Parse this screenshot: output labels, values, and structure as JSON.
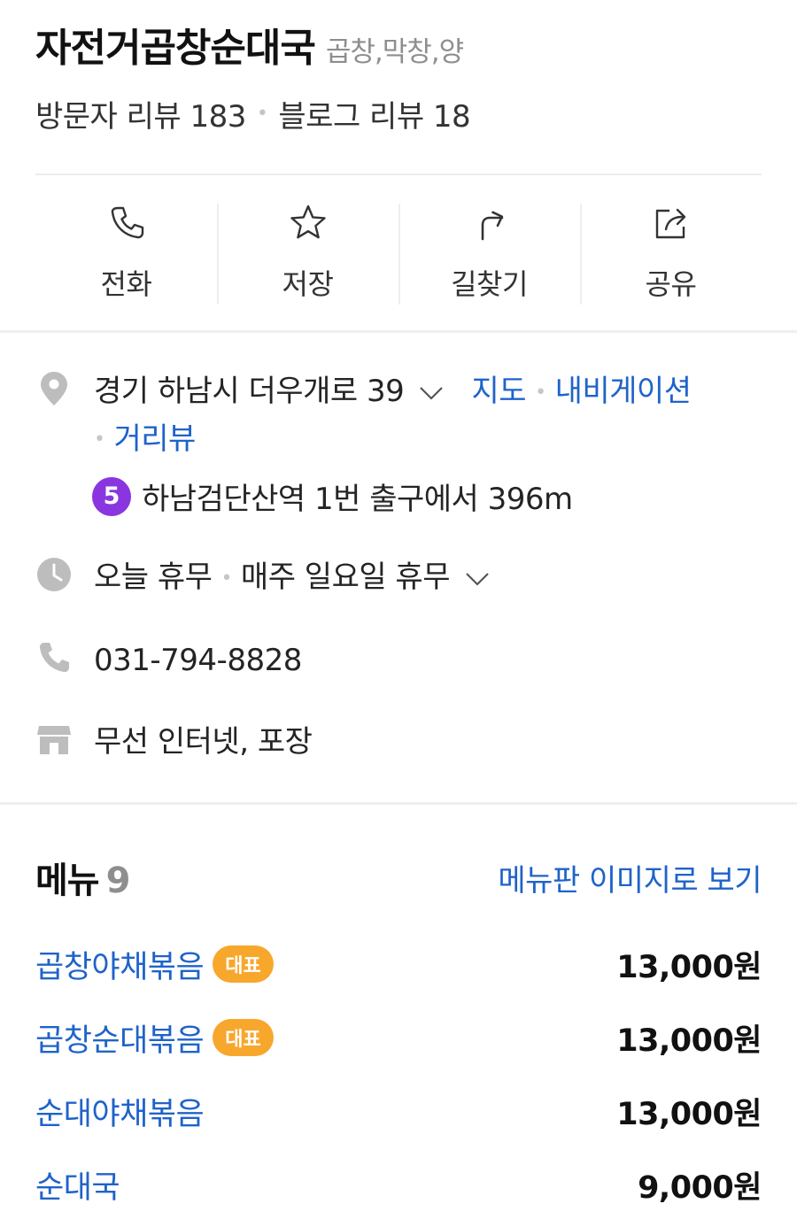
{
  "place": {
    "name": "자전거곱창순대국",
    "category": "곱창,막창,양",
    "visitor_reviews": "방문자 리뷰 183",
    "blog_reviews": "블로그 리뷰 18"
  },
  "actions": [
    {
      "label": "전화",
      "icon": "phone-icon"
    },
    {
      "label": "저장",
      "icon": "star-icon"
    },
    {
      "label": "길찾기",
      "icon": "directions-icon"
    },
    {
      "label": "공유",
      "icon": "share-icon"
    }
  ],
  "info": {
    "address": "경기 하남시 더우개로 39",
    "map_link": "지도",
    "navigation_link": "내비게이션",
    "street_view_link": "거리뷰",
    "subway_line": "5",
    "subway_line_color": "#8936E0",
    "subway_directions": "하남검단산역 1번 출구에서 396m",
    "hours_today": "오늘 휴무",
    "hours_weekly": "매주 일요일 휴무",
    "phone": "031-794-8828",
    "amenities": "무선 인터넷, 포장"
  },
  "menu": {
    "title": "메뉴",
    "count": "9",
    "board_link": "메뉴판 이미지로 보기",
    "items": [
      {
        "name": "곱창야채볶음",
        "badge": "대표",
        "price": "13,000원"
      },
      {
        "name": "곱창순대볶음",
        "badge": "대표",
        "price": "13,000원"
      },
      {
        "name": "순대야채볶음",
        "badge": "",
        "price": "13,000원"
      },
      {
        "name": "순대국",
        "badge": "",
        "price": "9,000원"
      }
    ]
  },
  "colors": {
    "link_blue": "#1F63C9",
    "badge_orange": "#F8A72D",
    "icon_gray": "#BDBDBD"
  }
}
